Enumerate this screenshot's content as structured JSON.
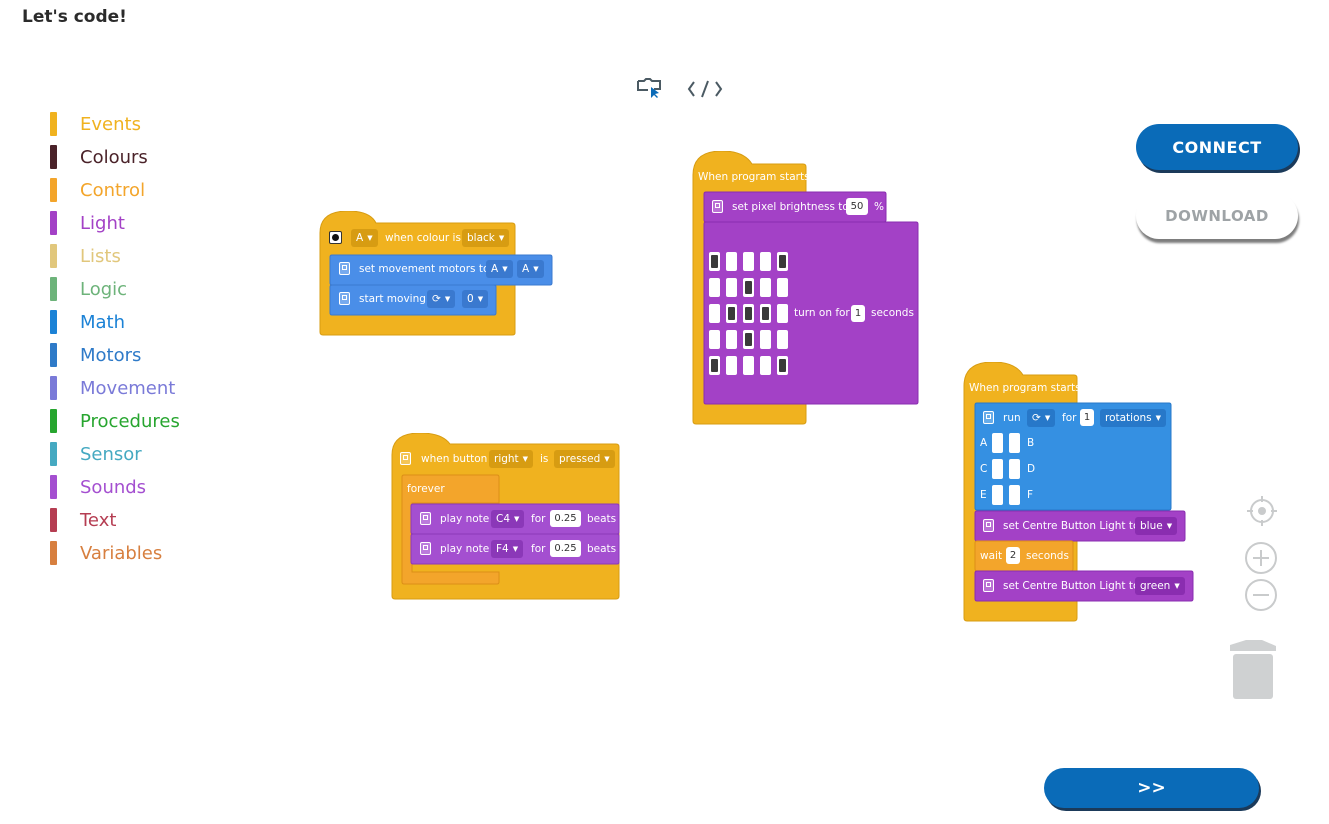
{
  "page": {
    "title": "Let's code!"
  },
  "categories": [
    {
      "label": "Events",
      "color": "#f0b21f"
    },
    {
      "label": "Colours",
      "color": "#4a2229"
    },
    {
      "label": "Control",
      "color": "#f3a52b"
    },
    {
      "label": "Light",
      "color": "#a341c6"
    },
    {
      "label": "Lists",
      "color": "#e1c77c"
    },
    {
      "label": "Logic",
      "color": "#6db37a"
    },
    {
      "label": "Math",
      "color": "#1b82d6"
    },
    {
      "label": "Motors",
      "color": "#2e7ac8"
    },
    {
      "label": "Movement",
      "color": "#7a7ad8"
    },
    {
      "label": "Procedures",
      "color": "#27a52f"
    },
    {
      "label": "Sensor",
      "color": "#45a9c1"
    },
    {
      "label": "Sounds",
      "color": "#a44fd0"
    },
    {
      "label": "Text",
      "color": "#b53d52"
    },
    {
      "label": "Variables",
      "color": "#d77f3f"
    }
  ],
  "toolbar": {
    "blocks_view_icon": "block-cursor-icon",
    "code_view_icon": "code-brackets-icon"
  },
  "buttons": {
    "connect": "CONNECT",
    "download": "DOWNLOAD",
    "next": ">>"
  },
  "blocks": {
    "colour": {
      "port": "A",
      "when_label": "when colour is",
      "colour": "black",
      "set_motors": "set movement motors to",
      "motor1": "A",
      "motor2": "A",
      "start_moving": "start moving",
      "speed": "0"
    },
    "pixels": {
      "hat": "When program starts",
      "brightness_label": "set pixel brightness to",
      "brightness": "50",
      "pct": "%",
      "turn_on": "turn on for",
      "duration": "1",
      "seconds": "seconds",
      "grid": [
        [
          1,
          0,
          0,
          0,
          1
        ],
        [
          0,
          0,
          1,
          0,
          0
        ],
        [
          0,
          1,
          1,
          1,
          0
        ],
        [
          0,
          0,
          1,
          0,
          0
        ],
        [
          1,
          0,
          0,
          0,
          1
        ]
      ]
    },
    "button": {
      "when": "when button",
      "button": "right",
      "is": "is",
      "state": "pressed",
      "forever": "forever",
      "play": "play note",
      "note1": "C4",
      "note2": "F4",
      "for": "for",
      "beats_val": "0.25",
      "beats": "beats"
    },
    "motor": {
      "hat": "When program starts",
      "run": "run",
      "for": "for",
      "rotations_val": "1",
      "rotations": "rotations",
      "ports": [
        "A",
        "B",
        "C",
        "D",
        "E",
        "F"
      ],
      "set_light": "set Centre Button Light to",
      "colour1": "blue",
      "wait": "wait",
      "wait_val": "2",
      "seconds": "seconds",
      "colour2": "green"
    }
  },
  "controls": {
    "center": "crosshair-icon",
    "zoom_in": "zoom-in-icon",
    "zoom_out": "zoom-out-icon",
    "trash": "trash-icon"
  }
}
